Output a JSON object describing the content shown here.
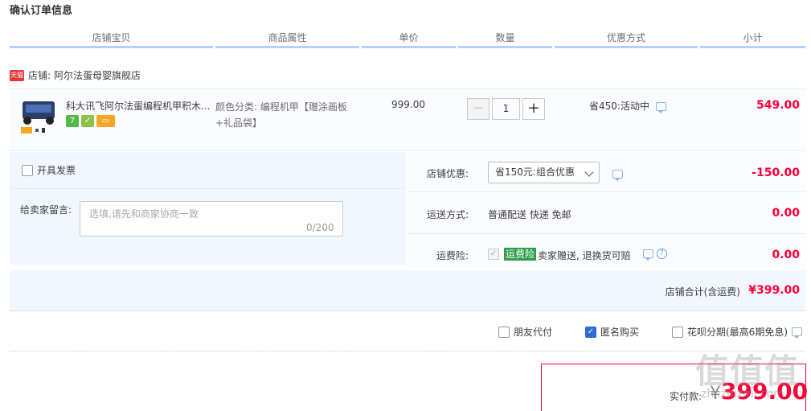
{
  "title": "确认订单信息",
  "columns": [
    "店铺宝贝",
    "商品属性",
    "单价",
    "数量",
    "优惠方式",
    "小计"
  ],
  "shop": {
    "badge": "天猫",
    "label": "店铺:",
    "name": "阿尔法蛋母婴旗舰店"
  },
  "item": {
    "title": "科大讯飞阿尔法蛋编程机甲积木...",
    "attr_line1": "颜色分类: 编程机甲【赠涂画板",
    "attr_line2": "+礼品袋】",
    "price": "999.00",
    "quantity": "1",
    "minus": "−",
    "plus": "+",
    "discount": "省450:活动中",
    "subtotal": "549.00",
    "badge_colors": [
      "#53b947",
      "#8bc34a",
      "#f5a623"
    ]
  },
  "invoice_label": "开具发票",
  "remark": {
    "label": "给卖家留言:",
    "placeholder": "选填,请先和商家协商一致",
    "count": "0/200"
  },
  "shop_discount": {
    "label": "店铺优惠:",
    "selected": "省150元:组合优惠",
    "amount": "-150.00"
  },
  "shipping": {
    "label": "运送方式:",
    "value": "普通配送 快递 免邮",
    "amount": "0.00"
  },
  "insurance": {
    "label": "运费险:",
    "tag": "运费险",
    "desc": "卖家赠送, 退换货可赔",
    "amount": "0.00"
  },
  "shop_total": {
    "label": "店铺合计(含运费)",
    "value": "¥399.00"
  },
  "options": {
    "friend_pay": "朋友代付",
    "anonymous": "匿名购买",
    "huabei": "花呗分期(最高6期免息)"
  },
  "pay": {
    "label": "实付款:",
    "currency": "¥",
    "value": "399.00"
  },
  "watermark": {
    "text": "值值值",
    "site": "zhi.zhizmi.com"
  },
  "colors": {
    "accent_red": "#ff0036",
    "header_line": "#b2d1ff",
    "pane_bg": "#f2f7ff"
  }
}
